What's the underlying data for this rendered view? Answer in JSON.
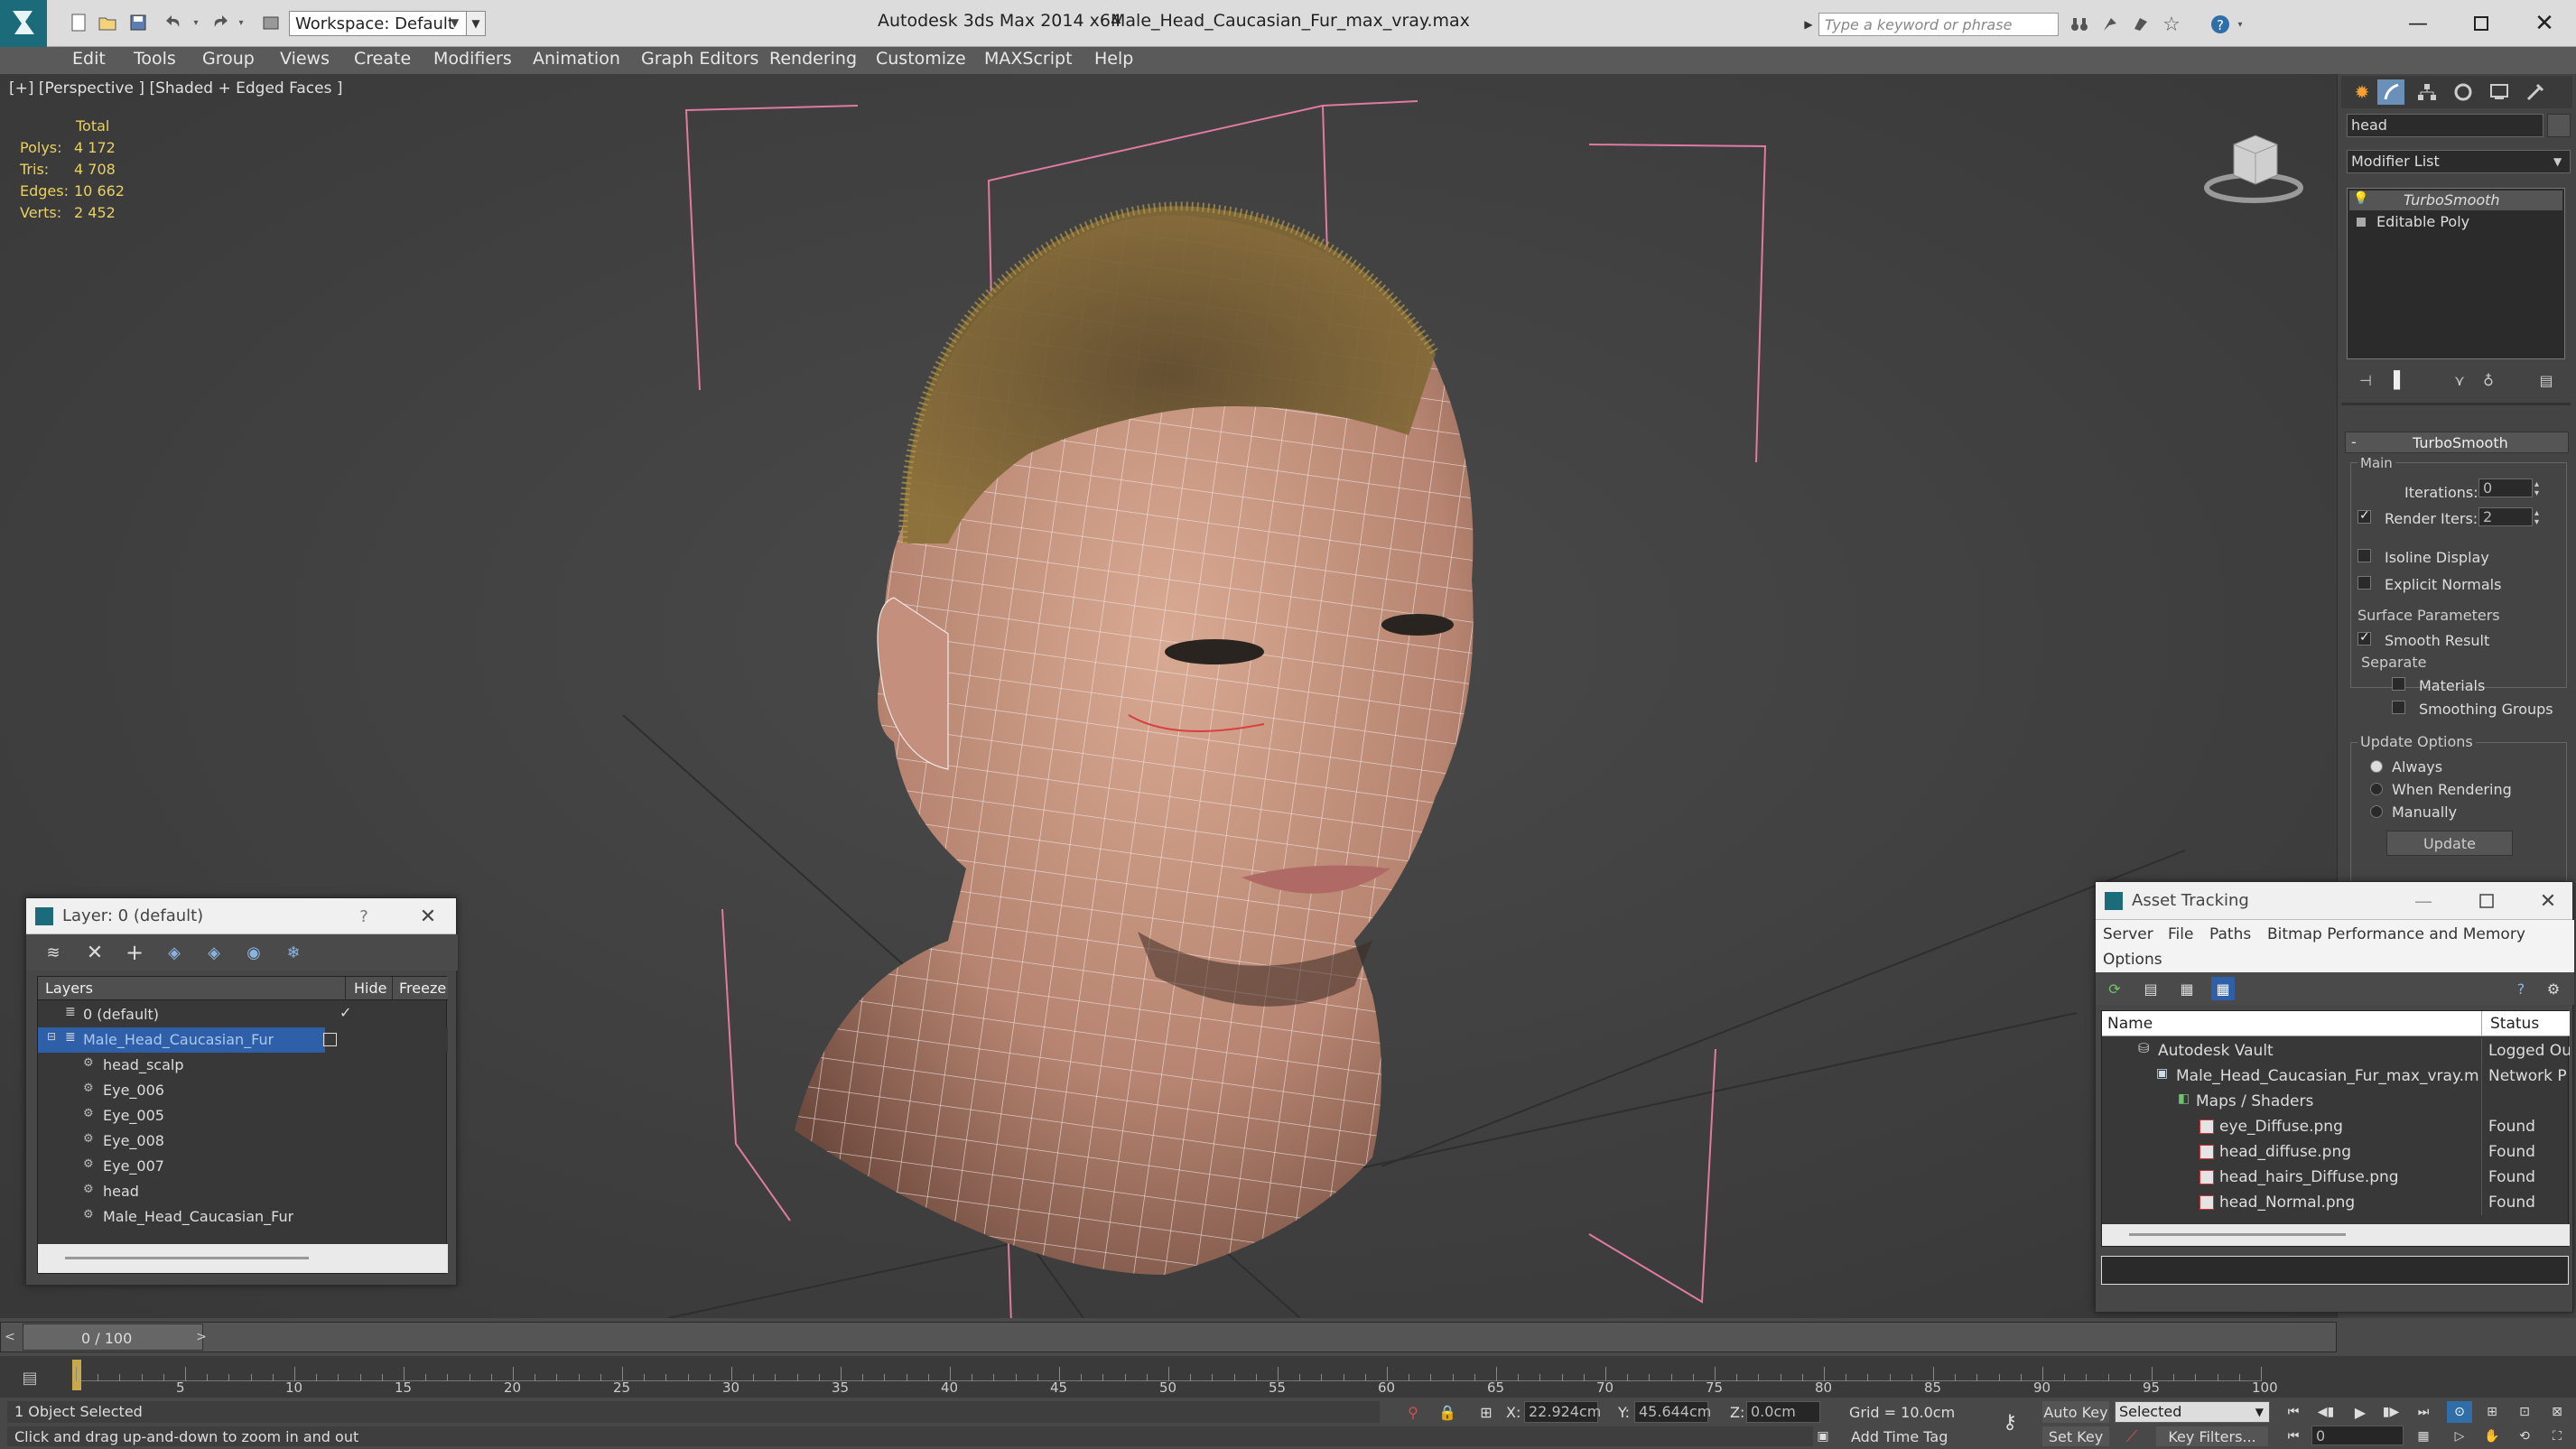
{
  "titlebar": {
    "workspace_label": "Workspace: Default",
    "app_title": "Autodesk 3ds Max  2014 x64",
    "file_name": "Male_Head_Caucasian_Fur_max_vray.max",
    "search_placeholder": "Type a keyword or phrase"
  },
  "menu": [
    "Edit",
    "Tools",
    "Group",
    "Views",
    "Create",
    "Modifiers",
    "Animation",
    "Graph Editors",
    "Rendering",
    "Customize",
    "MAXScript",
    "Help"
  ],
  "viewport": {
    "label": "[+] [Perspective ] [Shaded + Edged Faces ]",
    "stats_header": "Total",
    "stats": [
      {
        "label": "Polys:",
        "value": "4 172"
      },
      {
        "label": "Tris:",
        "value": "4 708"
      },
      {
        "label": "Edges:",
        "value": "10 662"
      },
      {
        "label": "Verts:",
        "value": "2 452"
      }
    ]
  },
  "command_panel": {
    "object_name": "head",
    "modifier_list": "Modifier List",
    "stack": [
      "TurboSmooth",
      "Editable Poly"
    ],
    "rollout_title": "TurboSmooth",
    "main_group": "Main",
    "iterations_label": "Iterations:",
    "iterations_value": "0",
    "render_iters_label": "Render Iters:",
    "render_iters_value": "2",
    "isoline_display": "Isoline Display",
    "explicit_normals": "Explicit Normals",
    "surface_parameters": "Surface Parameters",
    "smooth_result": "Smooth Result",
    "separate": "Separate",
    "materials": "Materials",
    "smoothing_groups": "Smoothing Groups",
    "update_options": "Update Options",
    "always": "Always",
    "when_rendering": "When Rendering",
    "manually": "Manually",
    "update_button": "Update"
  },
  "layer_dialog": {
    "title": "Layer: 0 (default)",
    "help": "?",
    "col_layers": "Layers",
    "col_hide": "Hide",
    "col_freeze": "Freeze",
    "rows": [
      "0 (default)",
      "Male_Head_Caucasian_Fur",
      "head_scalp",
      "Eye_006",
      "Eye_005",
      "Eye_008",
      "Eye_007",
      "head",
      "Male_Head_Caucasian_Fur"
    ]
  },
  "asset_tracking": {
    "title": "Asset Tracking",
    "menu": [
      "Server",
      "File",
      "Paths",
      "Bitmap Performance and Memory"
    ],
    "menu2": "Options",
    "col_name": "Name",
    "col_status": "Status",
    "rows": [
      {
        "name": "Autodesk Vault",
        "status": "Logged Ou"
      },
      {
        "name": "Male_Head_Caucasian_Fur_max_vray.max",
        "status": "Network P"
      },
      {
        "name": "Maps / Shaders",
        "status": ""
      },
      {
        "name": "eye_Diffuse.png",
        "status": "Found"
      },
      {
        "name": "head_diffuse.png",
        "status": "Found"
      },
      {
        "name": "head_hairs_Diffuse.png",
        "status": "Found"
      },
      {
        "name": "head_Normal.png",
        "status": "Found"
      }
    ]
  },
  "timeline": {
    "frame_label": "0 / 100",
    "ticks": [
      "5",
      "10",
      "15",
      "20",
      "25",
      "30",
      "35",
      "40",
      "45",
      "50",
      "55",
      "60",
      "65",
      "70",
      "75",
      "80",
      "85",
      "90",
      "95",
      "100"
    ]
  },
  "status": {
    "selection": "1 Object Selected",
    "prompt": "Click and drag up-and-down to zoom in and out",
    "x_label": "X:",
    "x_value": "22.924cm",
    "y_label": "Y:",
    "y_value": "45.644cm",
    "z_label": "Z:",
    "z_value": "0.0cm",
    "grid": "Grid = 10.0cm",
    "add_time_tag": "Add Time Tag",
    "auto_key": "Auto Key",
    "set_key": "Set Key",
    "selected_dropdown": "Selected",
    "key_filters": "Key Filters...",
    "frame_field": "0"
  }
}
